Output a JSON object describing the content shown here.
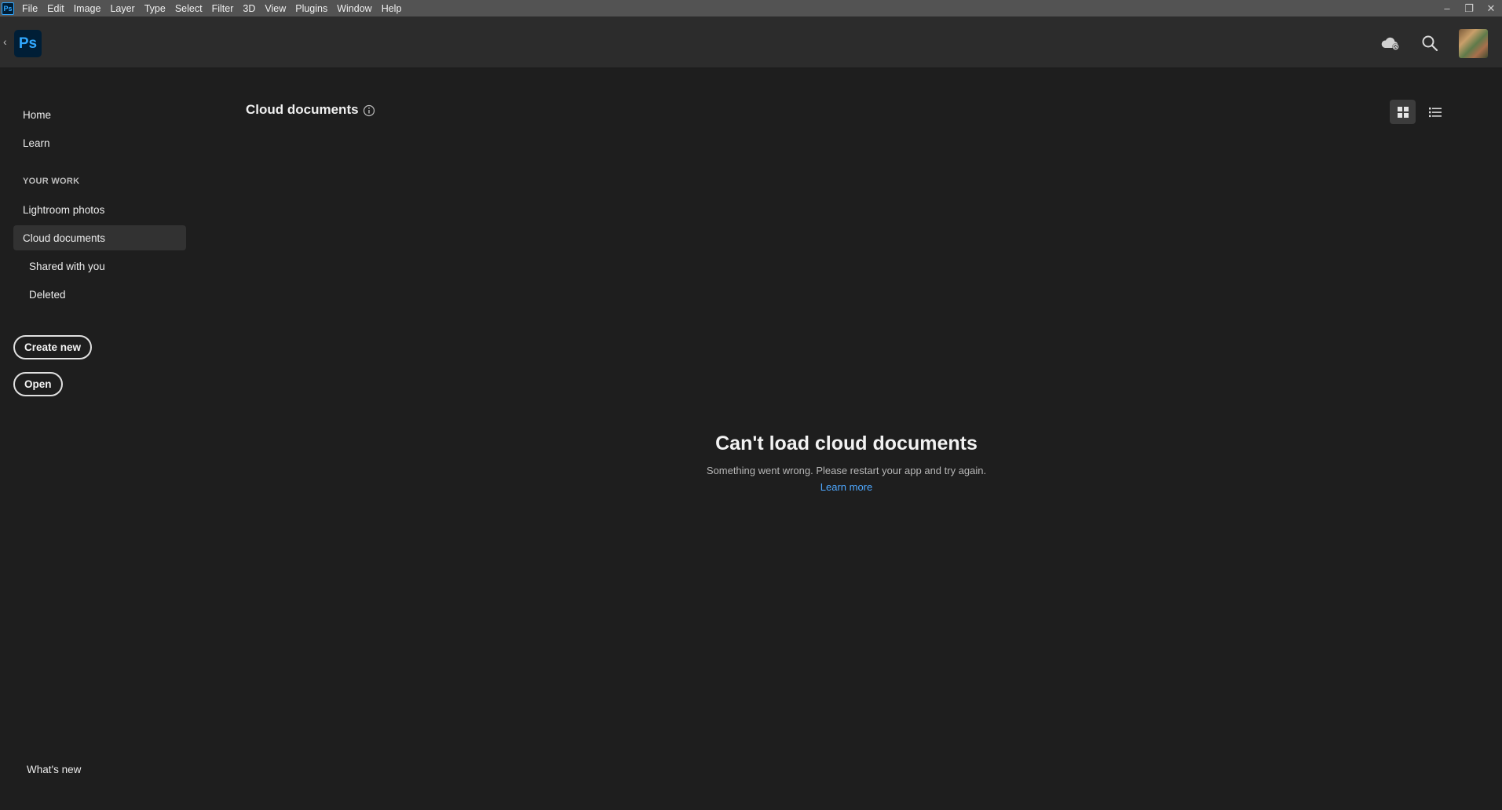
{
  "menubar": {
    "app_badge": "Ps",
    "items": [
      "File",
      "Edit",
      "Image",
      "Layer",
      "Type",
      "Select",
      "Filter",
      "3D",
      "View",
      "Plugins",
      "Window",
      "Help"
    ],
    "window_controls": {
      "minimize": "–",
      "restore": "❐",
      "close": "✕"
    }
  },
  "header": {
    "back_glyph": "‹",
    "logo_text": "Ps",
    "icons": [
      "cloud-sync-icon",
      "search-icon"
    ]
  },
  "sidebar": {
    "top_items": [
      "Home",
      "Learn"
    ],
    "section_label": "YOUR WORK",
    "work_items": [
      "Lightroom photos",
      "Cloud documents"
    ],
    "sub_items": [
      "Shared with you",
      "Deleted"
    ],
    "selected": "Cloud documents",
    "create_new_label": "Create new",
    "open_label": "Open",
    "whats_new_label": "What's new"
  },
  "main": {
    "title": "Cloud documents",
    "view_modes": [
      "grid",
      "list"
    ],
    "active_view": "grid",
    "empty_state": {
      "title": "Can't load cloud documents",
      "message": "Something went wrong. Please restart your app and try again.",
      "link": "Learn more"
    }
  },
  "colors": {
    "background": "#1e1e1e",
    "header": "#2c2c2c",
    "menubar": "#535353",
    "ps_blue": "#31a8ff",
    "ps_navy": "#001e36",
    "link": "#4ea8ff"
  }
}
